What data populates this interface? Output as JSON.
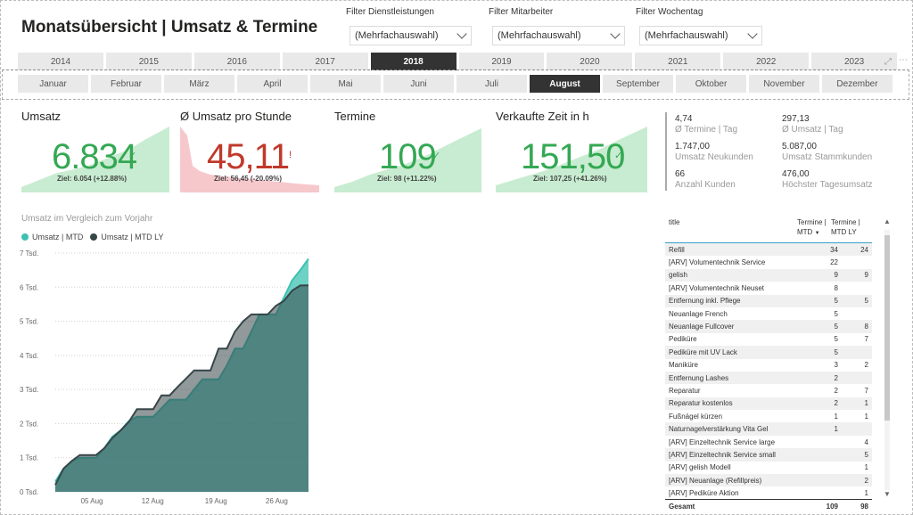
{
  "title": "Monatsübersicht | Umsatz & Termine",
  "filters": [
    {
      "label": "Filter Dienstleistungen",
      "value": "(Mehrfachauswahl)"
    },
    {
      "label": "Filter Mitarbeiter",
      "value": "(Mehrfachauswahl)"
    },
    {
      "label": "Filter Wochentag",
      "value": "(Mehrfachauswahl)"
    }
  ],
  "years": [
    "2014",
    "2015",
    "2016",
    "2017",
    "2018",
    "2019",
    "2020",
    "2021",
    "2022",
    "2023"
  ],
  "selected_year": "2018",
  "months": [
    "Januar",
    "Februar",
    "März",
    "April",
    "Mai",
    "Juni",
    "Juli",
    "August",
    "September",
    "Oktober",
    "November",
    "Dezember"
  ],
  "selected_month": "August",
  "kpis": [
    {
      "title": "Umsatz",
      "value": "6.834",
      "goal": "Ziel: 6.054 (+12.88%)",
      "status": "good",
      "color": "#34a853"
    },
    {
      "title": "Ø Umsatz pro Stunde",
      "value": "45,11",
      "goal": "Ziel: 56,45 (-20.09%)",
      "status": "bad",
      "color": "#c0392b"
    },
    {
      "title": "Termine",
      "value": "109",
      "goal": "Ziel: 98 (+11.22%)",
      "status": "good",
      "color": "#34a853"
    },
    {
      "title": "Verkaufte Zeit in h",
      "value": "151,50",
      "goal": "Ziel: 107,25 (+41.26%)",
      "status": "good",
      "color": "#34a853"
    }
  ],
  "stats": [
    {
      "value": "4,74",
      "label": "Ø Termine | Tag"
    },
    {
      "value": "297,13",
      "label": "Ø Umsatz | Tag"
    },
    {
      "value": "1.747,00",
      "label": "Umsatz Neukunden"
    },
    {
      "value": "5.087,00",
      "label": "Umsatz Stammkunden"
    },
    {
      "value": "66",
      "label": "Anzahl Kunden"
    },
    {
      "value": "476,00",
      "label": "Höchster Tagesumsatz"
    }
  ],
  "area_chart": {
    "title": "Umsatz im Vergleich zum Vorjahr",
    "legend": [
      {
        "name": "Umsatz | MTD",
        "color": "#3cc1b1"
      },
      {
        "name": "Umsatz | MTD LY",
        "color": "#374649"
      }
    ]
  },
  "chart_data": {
    "type": "area",
    "title": "Umsatz im Vergleich zum Vorjahr",
    "y_ticks": [
      "0 Tsd.",
      "1 Tsd.",
      "2 Tsd.",
      "3 Tsd.",
      "4 Tsd.",
      "5 Tsd.",
      "6 Tsd.",
      "7 Tsd."
    ],
    "x_ticks": [
      "05 Aug",
      "12 Aug",
      "19 Aug",
      "26 Aug"
    ],
    "ylim": [
      0,
      7000
    ],
    "x": [
      1,
      2,
      3,
      4,
      5,
      6,
      7,
      8,
      9,
      10,
      11,
      12,
      13,
      14,
      15,
      16,
      17,
      18,
      19,
      20,
      21,
      22,
      23,
      24,
      25,
      26,
      27,
      28,
      29,
      30,
      31
    ],
    "series": [
      {
        "name": "Umsatz | MTD",
        "values": [
          300,
          680,
          890,
          1000,
          1000,
          1000,
          1280,
          1620,
          1800,
          2080,
          2200,
          2200,
          2200,
          2450,
          2700,
          2700,
          2700,
          3000,
          3300,
          3300,
          3300,
          3700,
          4200,
          4200,
          4700,
          5200,
          5200,
          5200,
          5700,
          6200,
          6500,
          6834
        ]
      },
      {
        "name": "Umsatz | MTD LY",
        "values": [
          200,
          680,
          900,
          1080,
          1080,
          1080,
          1280,
          1580,
          1800,
          2050,
          2420,
          2420,
          2420,
          2830,
          2830,
          3080,
          3320,
          3560,
          3560,
          3560,
          4200,
          4200,
          4700,
          5000,
          5200,
          5200,
          5200,
          5450,
          5600,
          5900,
          6050,
          6054
        ]
      }
    ]
  },
  "table": {
    "headers": [
      "title",
      "Termine | MTD",
      "Termine | MTD LY"
    ],
    "rows": [
      [
        "Refill",
        "34",
        "24"
      ],
      [
        "[ARV] Volumentechnik Service",
        "22",
        ""
      ],
      [
        "gelish",
        "9",
        "9"
      ],
      [
        "[ARV] Volumentechnik Neuset",
        "8",
        ""
      ],
      [
        "Entfernung inkl. Pflege",
        "5",
        "5"
      ],
      [
        "Neuanlage French",
        "5",
        ""
      ],
      [
        "Neuanlage Fullcover",
        "5",
        "8"
      ],
      [
        "Pediküre",
        "5",
        "7"
      ],
      [
        "Pediküre mit UV Lack",
        "5",
        ""
      ],
      [
        "Maniküre",
        "3",
        "2"
      ],
      [
        "Entfernung Lashes",
        "2",
        ""
      ],
      [
        "Reparatur",
        "2",
        "7"
      ],
      [
        "Reparatur kostenlos",
        "2",
        "1"
      ],
      [
        "Fußnägel kürzen",
        "1",
        "1"
      ],
      [
        "Naturnagelverstärkung Vita Gel",
        "1",
        ""
      ],
      [
        "[ARV] Einzeltechnik Service large",
        "",
        "4"
      ],
      [
        "[ARV] Einzeltechnik Service small",
        "",
        "5"
      ],
      [
        "[ARV] gelish Modell",
        "",
        "1"
      ],
      [
        "[ARV] Neuanlage (Refillpreis)",
        "",
        "2"
      ],
      [
        "[ARV] Pediküre Aktion",
        "",
        "1"
      ]
    ],
    "total": [
      "Gesamt",
      "109",
      "98"
    ]
  }
}
